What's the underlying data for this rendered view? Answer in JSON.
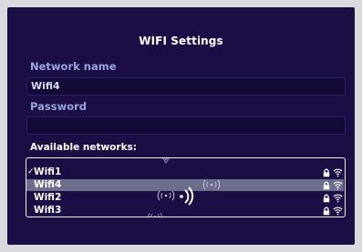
{
  "dialog": {
    "title": "WIFI Settings",
    "network_name_label": "Network name",
    "network_name_value": "Wifi4",
    "password_label": "Password",
    "password_value": "",
    "available_label": "Available networks:"
  },
  "networks": [
    {
      "name": "Wifi1",
      "connected": true,
      "check": "✓",
      "secured": true
    },
    {
      "name": "Wifi4",
      "selected": true,
      "secured": true
    },
    {
      "name": "Wifi2",
      "secured": true
    },
    {
      "name": "Wifi3",
      "secured": true
    }
  ],
  "icons": [
    "lock-icon",
    "wifi-icon",
    "wifi-scanning-icon",
    "checkmark-icon"
  ],
  "colors": {
    "background": "#1b0e44",
    "label": "#9aa6dc",
    "selected_row": "#6e6d8e",
    "text": "#ffffff"
  }
}
